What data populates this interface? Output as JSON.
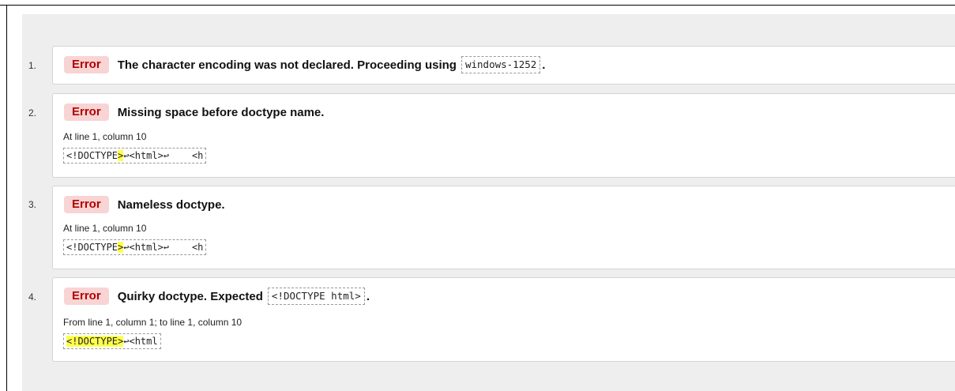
{
  "messages": [
    {
      "index": "1.",
      "type": "Error",
      "text": "The character encoding was not declared. Proceeding using",
      "code": "windows-1252",
      "trail": "."
    },
    {
      "index": "2.",
      "type": "Error",
      "text": "Missing space before doctype name.",
      "location": "At line 1, column 10",
      "extract_pre": "<!DOCTYPE",
      "extract_hl": ">",
      "extract_post": "↩<html>↩    <h"
    },
    {
      "index": "3.",
      "type": "Error",
      "text": "Nameless doctype.",
      "location": "At line 1, column 10",
      "extract_pre": "<!DOCTYPE",
      "extract_hl": ">",
      "extract_post": "↩<html>↩    <h"
    },
    {
      "index": "4.",
      "type": "Error",
      "text": "Quirky doctype. Expected",
      "code": "<!DOCTYPE html>",
      "trail": ".",
      "location": "From line 1, column 1; to line 1, column 10",
      "extract_hl": "<!DOCTYPE>",
      "extract_post": "↩<html"
    }
  ],
  "colors": {
    "badge_bg": "#f8d4d4",
    "badge_text": "#b30000",
    "highlight": "#ffff4d",
    "panel_bg": "#eeeeee"
  }
}
